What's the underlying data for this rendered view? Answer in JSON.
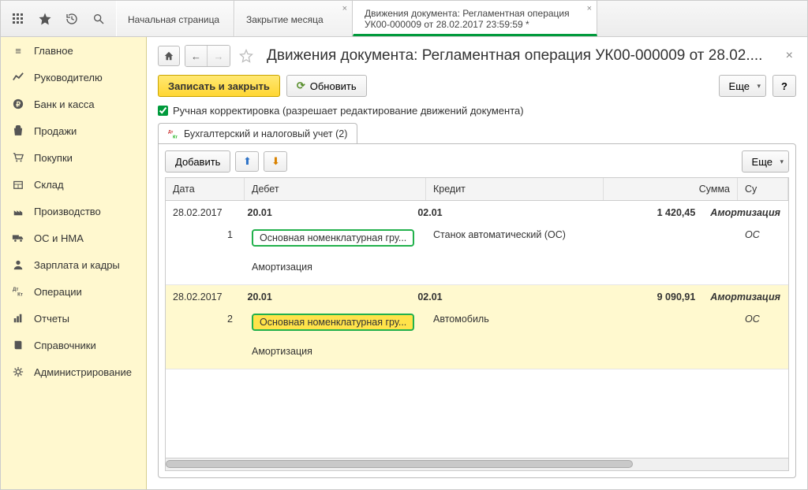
{
  "topbar": {
    "tabs": [
      {
        "title": "Начальная страница",
        "closable": false,
        "active": false
      },
      {
        "title": "Закрытие месяца",
        "closable": true,
        "active": false
      },
      {
        "title": "Движения документа: Регламентная операция УК00-000009 от 28.02.2017 23:59:59 *",
        "closable": true,
        "active": true
      }
    ]
  },
  "sidebar": {
    "items": [
      {
        "label": "Главное",
        "icon": "menu"
      },
      {
        "label": "Руководителю",
        "icon": "chart"
      },
      {
        "label": "Банк и касса",
        "icon": "ruble"
      },
      {
        "label": "Продажи",
        "icon": "bag"
      },
      {
        "label": "Покупки",
        "icon": "cart"
      },
      {
        "label": "Склад",
        "icon": "box"
      },
      {
        "label": "Производство",
        "icon": "factory"
      },
      {
        "label": "ОС и НМА",
        "icon": "truck"
      },
      {
        "label": "Зарплата и кадры",
        "icon": "person"
      },
      {
        "label": "Операции",
        "icon": "ops"
      },
      {
        "label": "Отчеты",
        "icon": "report"
      },
      {
        "label": "Справочники",
        "icon": "book"
      },
      {
        "label": "Администрирование",
        "icon": "gear"
      }
    ]
  },
  "page": {
    "title": "Движения документа: Регламентная операция УК00-000009 от 28.02....",
    "save_close": "Записать и закрыть",
    "refresh": "Обновить",
    "more": "Еще",
    "help": "?",
    "checkbox_label": "Ручная корректировка (разрешает редактирование движений документа)",
    "panel_tab": "Бухгалтерский и налоговый учет (2)",
    "add": "Добавить"
  },
  "grid": {
    "headers": {
      "date": "Дата",
      "debit": "Дебет",
      "credit": "Кредит",
      "sum": "Сумма",
      "su": "Су"
    },
    "rows": [
      {
        "date": "28.02.2017",
        "num": "1",
        "debit_acc": "20.01",
        "debit_nom": "Основная номенклатурная гру...",
        "debit_amort": "Амортизация",
        "credit_acc": "02.01",
        "credit_desc": "Станок автоматический (ОС)",
        "sum": "1 420,45",
        "su1": "Амортизация",
        "su2": "ОС",
        "selected": false
      },
      {
        "date": "28.02.2017",
        "num": "2",
        "debit_acc": "20.01",
        "debit_nom": "Основная номенклатурная гру...",
        "debit_amort": "Амортизация",
        "credit_acc": "02.01",
        "credit_desc": "Автомобиль",
        "sum": "9 090,91",
        "su1": "Амортизация",
        "su2": "ОС",
        "selected": true
      }
    ]
  }
}
